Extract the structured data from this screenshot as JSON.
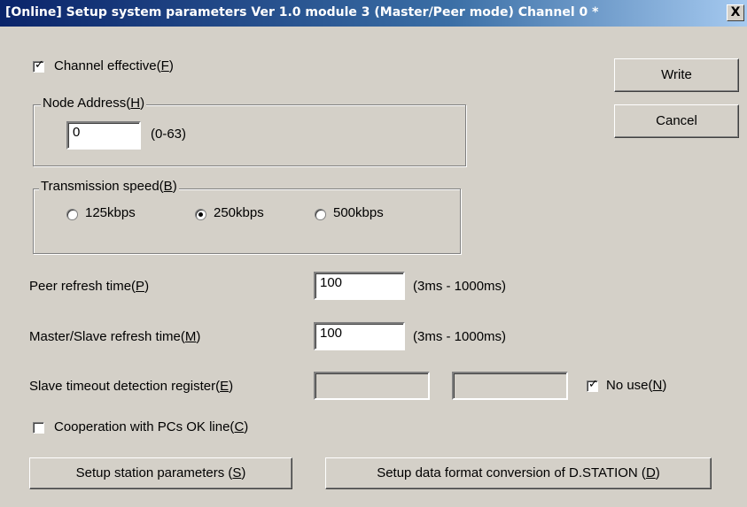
{
  "window": {
    "title": "[Online] Setup system parameters Ver 1.0 module 3 (Master/Peer mode) Channel 0 *",
    "close_glyph": "X"
  },
  "channel_effective": {
    "label": "Channel effective(",
    "mnemonic": "F",
    "suffix": ")",
    "checked": true
  },
  "node_address": {
    "legend": "Node Address(",
    "mnemonic": "H",
    "suffix": ")",
    "value": "0",
    "range": "(0-63)"
  },
  "transmission_speed": {
    "legend": "Transmission speed(",
    "mnemonic": "B",
    "suffix": ")",
    "options": [
      "125kbps",
      "250kbps",
      "500kbps"
    ],
    "selected": "250kbps"
  },
  "peer_refresh": {
    "label": "Peer refresh time(",
    "mnemonic": "P",
    "suffix": ")",
    "value": "100",
    "range": "(3ms - 1000ms)"
  },
  "master_slave_refresh": {
    "label": "Master/Slave refresh time(",
    "mnemonic": "M",
    "suffix": ")",
    "value": "100",
    "range": "(3ms - 1000ms)"
  },
  "slave_timeout": {
    "label": "Slave timeout detection register(",
    "mnemonic": "E",
    "suffix": ")",
    "value1": "",
    "value2": "",
    "no_use": {
      "label": "No use(",
      "mnemonic": "N",
      "suffix": ")",
      "checked": true
    }
  },
  "cooperation": {
    "label": "Cooperation with PCs OK line(",
    "mnemonic": "C",
    "suffix": ")",
    "checked": false
  },
  "buttons": {
    "write": "Write",
    "cancel": "Cancel",
    "setup_station": {
      "label": "Setup station parameters (",
      "mnemonic": "S",
      "suffix": ")"
    },
    "setup_data_format": {
      "label": "Setup data format conversion of D.STATION (",
      "mnemonic": "D",
      "suffix": ")"
    }
  },
  "colors": {
    "face": "#d4d0c8",
    "title_start": "#0a246a",
    "title_end": "#a6caf0"
  }
}
